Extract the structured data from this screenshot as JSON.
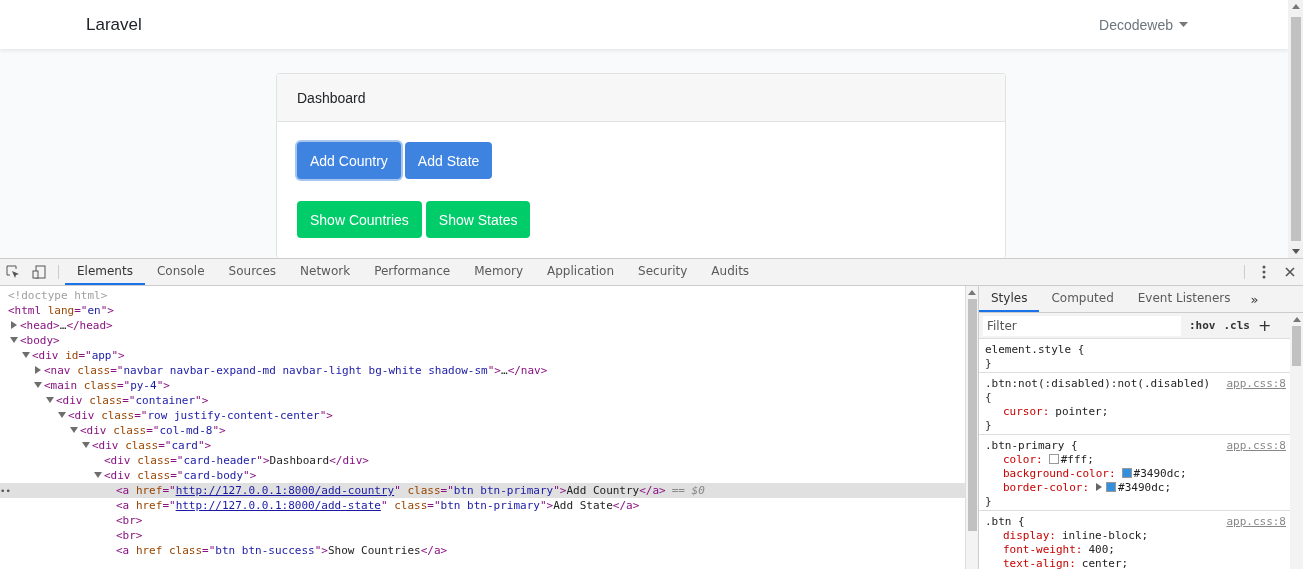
{
  "page": {
    "brand": "Laravel",
    "user_menu": "Decodeweb",
    "card": {
      "header": "Dashboard",
      "button_rows": [
        [
          {
            "label": "Add Country",
            "focused": true
          },
          {
            "label": "Add State",
            "focused": false
          }
        ],
        [
          {
            "label": "Show Countries",
            "focused": false
          },
          {
            "label": "Show States",
            "focused": false
          }
        ]
      ]
    }
  },
  "devtools": {
    "tabs": [
      {
        "label": "Elements",
        "selected": true
      },
      {
        "label": "Console",
        "selected": false
      },
      {
        "label": "Sources",
        "selected": false
      },
      {
        "label": "Network",
        "selected": false
      },
      {
        "label": "Performance",
        "selected": false
      },
      {
        "label": "Memory",
        "selected": false
      },
      {
        "label": "Application",
        "selected": false
      },
      {
        "label": "Security",
        "selected": false
      },
      {
        "label": "Audits",
        "selected": false
      }
    ],
    "dom_tree": [
      {
        "selected": false,
        "segments": [
          {
            "kind": "comment",
            "text": "<!doctype html>"
          }
        ]
      },
      {
        "selected": false,
        "segments": [
          {
            "kind": "tag",
            "text": "<html "
          },
          {
            "kind": "attr",
            "text": "lang"
          },
          {
            "kind": "tag",
            "text": "=\""
          },
          {
            "kind": "value",
            "text": "en"
          },
          {
            "kind": "tag",
            "text": "\">"
          }
        ],
        "children": [
          {
            "selected": false,
            "expanded": false,
            "segments": [
              {
                "kind": "tag",
                "text": "<head>"
              },
              {
                "kind": "text",
                "text": "…"
              },
              {
                "kind": "tag",
                "text": "</head>"
              }
            ]
          },
          {
            "selected": false,
            "expanded": true,
            "segments": [
              {
                "kind": "tag",
                "text": "<body>"
              }
            ],
            "children": [
              {
                "selected": false,
                "expanded": true,
                "segments": [
                  {
                    "kind": "tag",
                    "text": "<div "
                  },
                  {
                    "kind": "attr",
                    "text": "id"
                  },
                  {
                    "kind": "tag",
                    "text": "=\""
                  },
                  {
                    "kind": "value",
                    "text": "app"
                  },
                  {
                    "kind": "tag",
                    "text": "\">"
                  }
                ],
                "children": [
                  {
                    "selected": false,
                    "expanded": false,
                    "segments": [
                      {
                        "kind": "tag",
                        "text": "<nav "
                      },
                      {
                        "kind": "attr",
                        "text": "class"
                      },
                      {
                        "kind": "tag",
                        "text": "=\""
                      },
                      {
                        "kind": "value",
                        "text": "navbar navbar-expand-md navbar-light bg-white shadow-sm"
                      },
                      {
                        "kind": "tag",
                        "text": "\">"
                      },
                      {
                        "kind": "text",
                        "text": "…"
                      },
                      {
                        "kind": "tag",
                        "text": "</nav>"
                      }
                    ]
                  },
                  {
                    "selected": false,
                    "expanded": true,
                    "segments": [
                      {
                        "kind": "tag",
                        "text": "<main "
                      },
                      {
                        "kind": "attr",
                        "text": "class"
                      },
                      {
                        "kind": "tag",
                        "text": "=\""
                      },
                      {
                        "kind": "value",
                        "text": "py-4"
                      },
                      {
                        "kind": "tag",
                        "text": "\">"
                      }
                    ],
                    "children": [
                      {
                        "selected": false,
                        "expanded": true,
                        "segments": [
                          {
                            "kind": "tag",
                            "text": "<div "
                          },
                          {
                            "kind": "attr",
                            "text": "class"
                          },
                          {
                            "kind": "tag",
                            "text": "=\""
                          },
                          {
                            "kind": "value",
                            "text": "container"
                          },
                          {
                            "kind": "tag",
                            "text": "\">"
                          }
                        ],
                        "children": [
                          {
                            "selected": false,
                            "expanded": true,
                            "segments": [
                              {
                                "kind": "tag",
                                "text": "<div "
                              },
                              {
                                "kind": "attr",
                                "text": "class"
                              },
                              {
                                "kind": "tag",
                                "text": "=\""
                              },
                              {
                                "kind": "value",
                                "text": "row justify-content-center"
                              },
                              {
                                "kind": "tag",
                                "text": "\">"
                              }
                            ],
                            "children": [
                              {
                                "selected": false,
                                "expanded": true,
                                "segments": [
                                  {
                                    "kind": "tag",
                                    "text": "<div "
                                  },
                                  {
                                    "kind": "attr",
                                    "text": "class"
                                  },
                                  {
                                    "kind": "tag",
                                    "text": "=\""
                                  },
                                  {
                                    "kind": "value",
                                    "text": "col-md-8"
                                  },
                                  {
                                    "kind": "tag",
                                    "text": "\">"
                                  }
                                ],
                                "children": [
                                  {
                                    "selected": false,
                                    "expanded": true,
                                    "segments": [
                                      {
                                        "kind": "tag",
                                        "text": "<div "
                                      },
                                      {
                                        "kind": "attr",
                                        "text": "class"
                                      },
                                      {
                                        "kind": "tag",
                                        "text": "=\""
                                      },
                                      {
                                        "kind": "value",
                                        "text": "card"
                                      },
                                      {
                                        "kind": "tag",
                                        "text": "\">"
                                      }
                                    ],
                                    "children": [
                                      {
                                        "selected": false,
                                        "segments": [
                                          {
                                            "kind": "tag",
                                            "text": "<div "
                                          },
                                          {
                                            "kind": "attr",
                                            "text": "class"
                                          },
                                          {
                                            "kind": "tag",
                                            "text": "=\""
                                          },
                                          {
                                            "kind": "value",
                                            "text": "card-header"
                                          },
                                          {
                                            "kind": "tag",
                                            "text": "\">"
                                          },
                                          {
                                            "kind": "text",
                                            "text": "Dashboard"
                                          },
                                          {
                                            "kind": "tag",
                                            "text": "</div>"
                                          }
                                        ]
                                      },
                                      {
                                        "selected": false,
                                        "expanded": true,
                                        "segments": [
                                          {
                                            "kind": "tag",
                                            "text": "<div "
                                          },
                                          {
                                            "kind": "attr",
                                            "text": "class"
                                          },
                                          {
                                            "kind": "tag",
                                            "text": "=\""
                                          },
                                          {
                                            "kind": "value",
                                            "text": "card-body"
                                          },
                                          {
                                            "kind": "tag",
                                            "text": "\">"
                                          }
                                        ],
                                        "children": [
                                          {
                                            "selected": true,
                                            "marker": "••",
                                            "segments": [
                                              {
                                                "kind": "tag",
                                                "text": "<a "
                                              },
                                              {
                                                "kind": "attr",
                                                "text": "href"
                                              },
                                              {
                                                "kind": "tag",
                                                "text": "=\""
                                              },
                                              {
                                                "kind": "link",
                                                "text": "http://127.0.0.1:8000/add-country"
                                              },
                                              {
                                                "kind": "tag",
                                                "text": "\" "
                                              },
                                              {
                                                "kind": "attr",
                                                "text": "class"
                                              },
                                              {
                                                "kind": "tag",
                                                "text": "=\""
                                              },
                                              {
                                                "kind": "value",
                                                "text": "btn btn-primary"
                                              },
                                              {
                                                "kind": "tag",
                                                "text": "\">"
                                              },
                                              {
                                                "kind": "text",
                                                "text": "Add Country"
                                              },
                                              {
                                                "kind": "tag",
                                                "text": "</a>"
                                              },
                                              {
                                                "kind": "note",
                                                "text": "== $0"
                                              }
                                            ]
                                          },
                                          {
                                            "selected": false,
                                            "segments": [
                                              {
                                                "kind": "tag",
                                                "text": "<a "
                                              },
                                              {
                                                "kind": "attr",
                                                "text": "href"
                                              },
                                              {
                                                "kind": "tag",
                                                "text": "=\""
                                              },
                                              {
                                                "kind": "link",
                                                "text": "http://127.0.0.1:8000/add-state"
                                              },
                                              {
                                                "kind": "tag",
                                                "text": "\" "
                                              },
                                              {
                                                "kind": "attr",
                                                "text": "class"
                                              },
                                              {
                                                "kind": "tag",
                                                "text": "=\""
                                              },
                                              {
                                                "kind": "value",
                                                "text": "btn btn-primary"
                                              },
                                              {
                                                "kind": "tag",
                                                "text": "\">"
                                              },
                                              {
                                                "kind": "text",
                                                "text": "Add State"
                                              },
                                              {
                                                "kind": "tag",
                                                "text": "</a>"
                                              }
                                            ]
                                          },
                                          {
                                            "selected": false,
                                            "segments": [
                                              {
                                                "kind": "tag",
                                                "text": "<br>"
                                              }
                                            ]
                                          },
                                          {
                                            "selected": false,
                                            "segments": [
                                              {
                                                "kind": "tag",
                                                "text": "<br>"
                                              }
                                            ]
                                          },
                                          {
                                            "selected": false,
                                            "segments": [
                                              {
                                                "kind": "tag",
                                                "text": "<a "
                                              },
                                              {
                                                "kind": "attr",
                                                "text": "href class"
                                              },
                                              {
                                                "kind": "tag",
                                                "text": "=\""
                                              },
                                              {
                                                "kind": "value",
                                                "text": "btn btn-success"
                                              },
                                              {
                                                "kind": "tag",
                                                "text": "\">"
                                              },
                                              {
                                                "kind": "text",
                                                "text": "Show Countries"
                                              },
                                              {
                                                "kind": "tag",
                                                "text": "</a>"
                                              }
                                            ]
                                          }
                                        ]
                                      }
                                    ]
                                  }
                                ]
                              }
                            ]
                          }
                        ]
                      }
                    ]
                  }
                ]
              }
            ]
          }
        ]
      }
    ],
    "styles": {
      "tabs": [
        {
          "label": "Styles",
          "selected": true
        },
        {
          "label": "Computed",
          "selected": false
        },
        {
          "label": "Event Listeners",
          "selected": false
        }
      ],
      "more": "»",
      "filter_placeholder": "Filter",
      "hov": ":hov",
      "cls": ".cls",
      "add": "+",
      "rules": [
        {
          "selector": "element.style {",
          "close": "}"
        },
        {
          "selector": ".btn:not(:disabled):not(.disabled)",
          "open": "{",
          "source": "app.css:8",
          "close": "}",
          "declarations": [
            {
              "property": "cursor:",
              "value": "pointer;"
            }
          ]
        },
        {
          "selector": ".btn-primary {",
          "source": "app.css:8",
          "close": "}",
          "declarations": [
            {
              "property": "color:",
              "value": "#fff;",
              "color": "#ffffff"
            },
            {
              "property": "background-color:",
              "value": "#3490dc;",
              "color": "#3490dc"
            },
            {
              "property": "border-color:",
              "value": "#3490dc;",
              "color": "#3490dc",
              "expandable": true
            }
          ]
        },
        {
          "selector": ".btn {",
          "source": "app.css:8",
          "declarations": [
            {
              "property": "display:",
              "value": "inline-block;"
            },
            {
              "property": "font-weight:",
              "value": "400;"
            },
            {
              "property": "text-align:",
              "value": "center;"
            }
          ]
        }
      ]
    }
  }
}
